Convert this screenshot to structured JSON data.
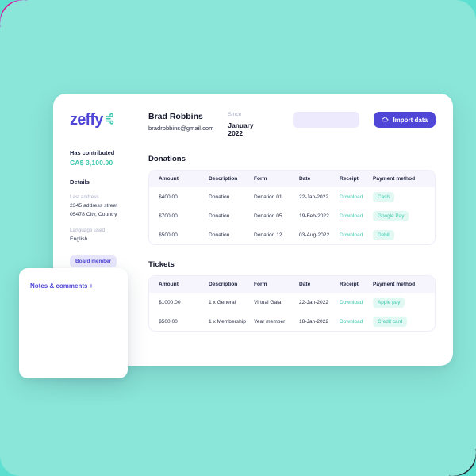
{
  "brand": {
    "logo_word": "zeffy",
    "logo_mark_name": "wind-lines-icon",
    "accent_indigo": "#4f46d8",
    "accent_teal": "#3ec9ae",
    "background_teal": "#8ae6d8"
  },
  "sidebar": {
    "contributed_label": "Has contributed",
    "contributed_amount": "CA$ 3,100.00",
    "details_heading": "Details",
    "last_address_label": "Last address",
    "address_line1": "2345 address street",
    "address_line2": "05478 City, Country",
    "language_label": "Language used",
    "language_value": "English",
    "board_badge": "Board member"
  },
  "header": {
    "name": "Brad Robbins",
    "email": "bradrobbins@gmail.com",
    "since_label": "Since",
    "since_value": "January 2022",
    "search_value": "",
    "search_placeholder": "",
    "import_button": "Import data",
    "import_icon_name": "cloud-upload-icon"
  },
  "columns": [
    "Amount",
    "Description",
    "Form",
    "Date",
    "Receipt",
    "Payment method"
  ],
  "donations": {
    "title": "Donations",
    "rows": [
      {
        "amount": "$400.00",
        "description": "Donation",
        "form": "Donation 01",
        "date": "22-Jan-2022",
        "receipt": "Download",
        "payment": "Cash"
      },
      {
        "amount": "$700.00",
        "description": "Donation",
        "form": "Donation 05",
        "date": "19-Feb-2022",
        "receipt": "Download",
        "payment": "Google Pay"
      },
      {
        "amount": "$500.00",
        "description": "Donation",
        "form": "Donation 12",
        "date": "03-Aug-2022",
        "receipt": "Download",
        "payment": "Debit"
      }
    ]
  },
  "tickets": {
    "title": "Tickets",
    "rows": [
      {
        "amount": "$1000.00",
        "description": "1 x General",
        "form": "Virtual Gala",
        "date": "22-Jan-2022",
        "receipt": "Download",
        "payment": "Apple pay"
      },
      {
        "amount": "$500.00",
        "description": "1 x Membership",
        "form": "Year member",
        "date": "18-Jan-2022",
        "receipt": "Download",
        "payment": "Credit card"
      }
    ]
  },
  "notes": {
    "title": "Notes & comments +"
  }
}
